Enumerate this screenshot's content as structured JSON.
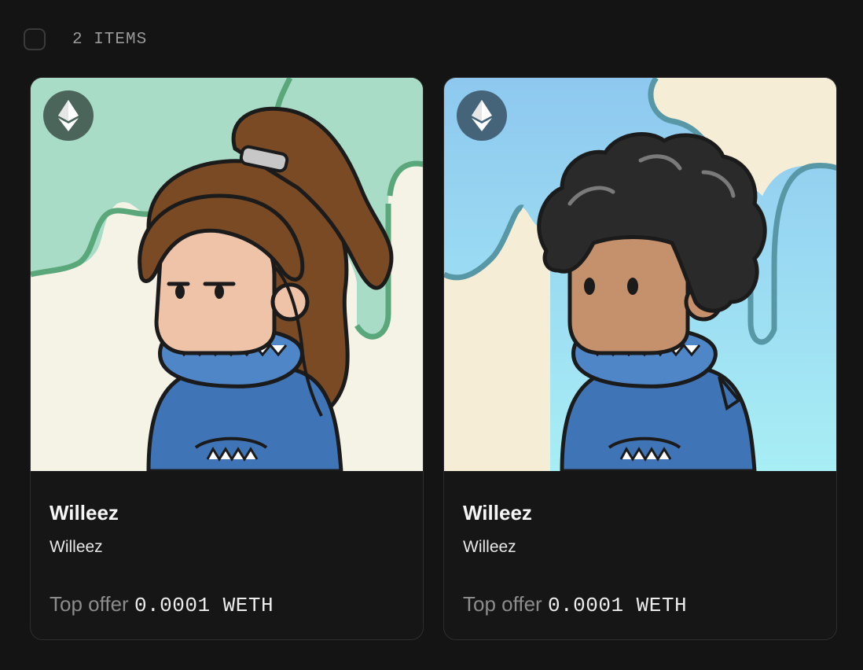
{
  "header": {
    "count_label": "2 ITEMS"
  },
  "colors": {
    "background": "#141414",
    "card_border": "#2e2e30",
    "muted_text": "#8c8c8c"
  },
  "cards": [
    {
      "name": "Willeez",
      "collection": "Willeez",
      "offer_label": "Top offer",
      "offer_value": "0.0001 WETH",
      "chain_icon": "ethereum-icon",
      "art": "girl-with-ponytail-shark-hoodie"
    },
    {
      "name": "Willeez",
      "collection": "Willeez",
      "offer_label": "Top offer",
      "offer_value": "0.0001 WETH",
      "chain_icon": "ethereum-icon",
      "art": "boy-with-afro-shark-hoodie"
    }
  ]
}
